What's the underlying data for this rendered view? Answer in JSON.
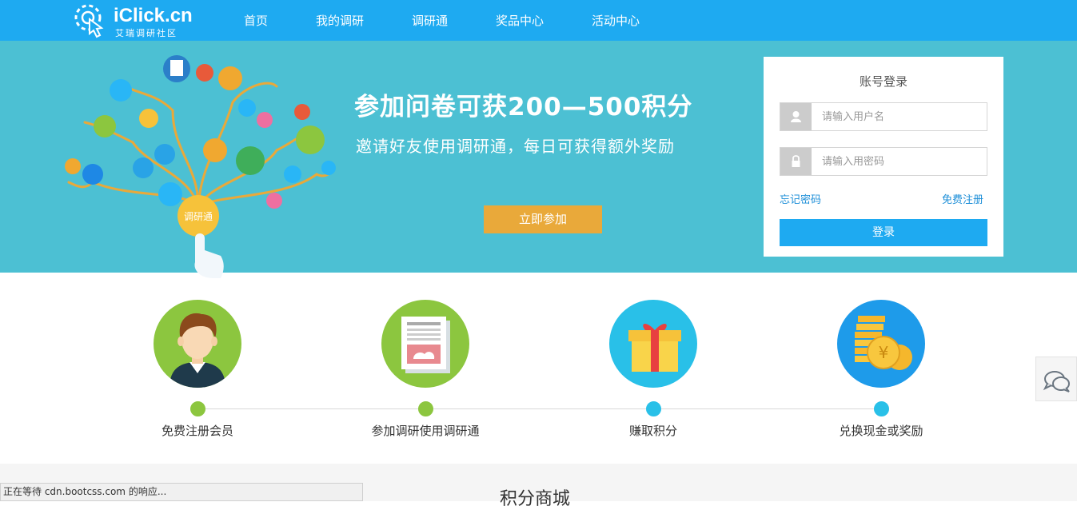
{
  "brand": {
    "logo_text": "iClick.cn",
    "logo_sub": "艾瑞调研社区"
  },
  "nav": {
    "items": [
      "首页",
      "我的调研",
      "调研通",
      "奖品中心",
      "活动中心"
    ]
  },
  "banner": {
    "headline": "参加问卷可获200—500积分",
    "subline": "邀请好友使用调研通，每日可获得额外奖励",
    "join_label": "立即参加",
    "tree_center_label": "调研通"
  },
  "login": {
    "title": "账号登录",
    "username_placeholder": "请输入用户名",
    "password_placeholder": "请输入用密码",
    "forgot_label": "忘记密码",
    "register_label": "免费注册",
    "submit_label": "登录"
  },
  "steps": [
    {
      "label": "免费注册会员",
      "dot_color": "#8cc63f"
    },
    {
      "label": "参加调研使用调研通",
      "dot_color": "#8cc63f"
    },
    {
      "label": "赚取积分",
      "dot_color": "#29c0e8"
    },
    {
      "label": "兑换现金或奖励",
      "dot_color": "#29c0e8"
    }
  ],
  "mall": {
    "title": "积分商城"
  },
  "status": {
    "text": "正在等待 cdn.bootcss.com 的响应..."
  },
  "colors": {
    "nav": "#1eaaf1",
    "banner": "#4cc0d3",
    "accent_orange": "#e9a93a"
  }
}
